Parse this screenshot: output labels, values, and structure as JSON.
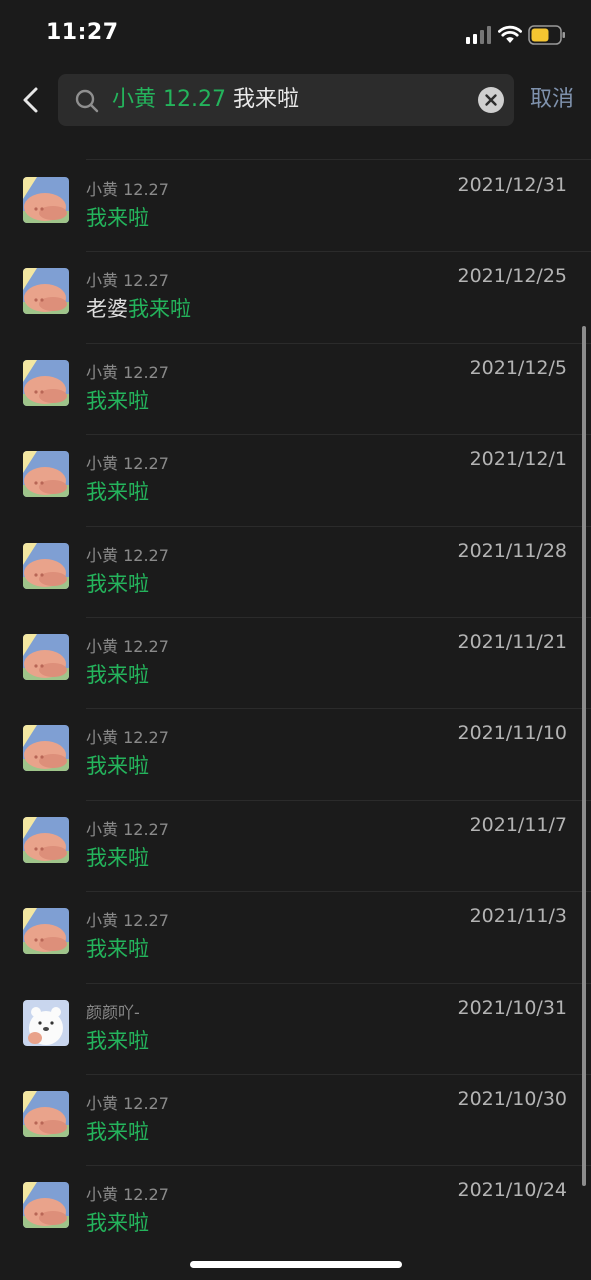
{
  "status_bar": {
    "time": "11:27",
    "battery_color": "#f4c531"
  },
  "search": {
    "query_highlight": "小黄 12.27",
    "query_rest": " 我来啦",
    "cancel_label": "取消",
    "highlight_color": "#24b45c"
  },
  "results": [
    {
      "sender": "小黄 12.27",
      "date": "2021/12/31",
      "prefix": "",
      "match": "我来啦",
      "avatar": "pig-avatar"
    },
    {
      "sender": "小黄 12.27",
      "date": "2021/12/25",
      "prefix": "老婆",
      "match": "我来啦",
      "avatar": "pig-avatar"
    },
    {
      "sender": "小黄 12.27",
      "date": "2021/12/5",
      "prefix": "",
      "match": "我来啦",
      "avatar": "pig-avatar"
    },
    {
      "sender": "小黄 12.27",
      "date": "2021/12/1",
      "prefix": "",
      "match": "我来啦",
      "avatar": "pig-avatar"
    },
    {
      "sender": "小黄 12.27",
      "date": "2021/11/28",
      "prefix": "",
      "match": "我来啦",
      "avatar": "pig-avatar"
    },
    {
      "sender": "小黄 12.27",
      "date": "2021/11/21",
      "prefix": "",
      "match": "我来啦",
      "avatar": "pig-avatar"
    },
    {
      "sender": "小黄 12.27",
      "date": "2021/11/10",
      "prefix": "",
      "match": "我来啦",
      "avatar": "pig-avatar"
    },
    {
      "sender": "小黄 12.27",
      "date": "2021/11/7",
      "prefix": "",
      "match": "我来啦",
      "avatar": "pig-avatar"
    },
    {
      "sender": "小黄 12.27",
      "date": "2021/11/3",
      "prefix": "",
      "match": "我来啦",
      "avatar": "pig-avatar"
    },
    {
      "sender": "颜颜吖-",
      "date": "2021/10/31",
      "prefix": "",
      "match": "我来啦",
      "avatar": "bear-avatar"
    },
    {
      "sender": "小黄 12.27",
      "date": "2021/10/30",
      "prefix": "",
      "match": "我来啦",
      "avatar": "pig-avatar"
    },
    {
      "sender": "小黄 12.27",
      "date": "2021/10/24",
      "prefix": "",
      "match": "我来啦",
      "avatar": "pig-avatar"
    }
  ]
}
